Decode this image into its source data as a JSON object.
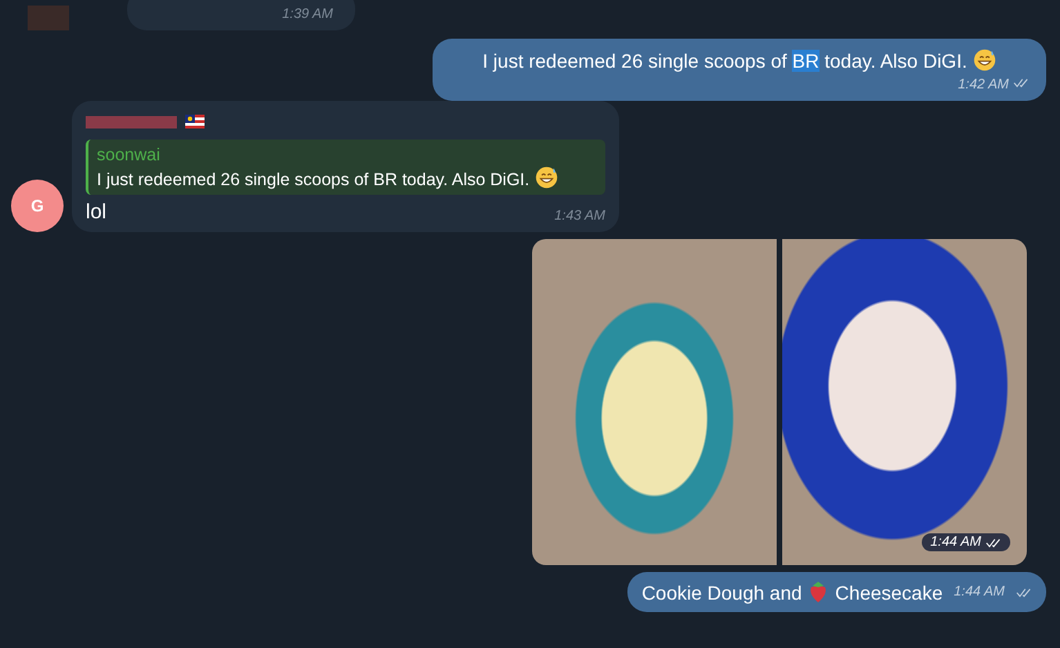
{
  "messages": [
    {
      "kind": "partial",
      "time": "1:39 AM"
    },
    {
      "kind": "text",
      "parts": [
        {
          "text": "I just redeemed 26 single scoops of ",
          "selected": false
        },
        {
          "text": "BR",
          "selected": true
        },
        {
          "text": " today. Also DiGI.",
          "selected": false
        }
      ],
      "time": "1:42 AM",
      "read": true
    },
    {
      "kind": "reply",
      "avatar": "G",
      "flag": true,
      "reply_to": {
        "author": "soonwai",
        "text": "I just redeemed 26 single scoops of BR today. Also DiGI."
      },
      "text": "lol",
      "time": "1:43 AM"
    },
    {
      "kind": "album",
      "time": "1:44 AM",
      "read": true
    },
    {
      "kind": "caption",
      "before": "Cookie Dough and",
      "after": "Cheesecake",
      "time": "1:44 AM",
      "read": true
    }
  ]
}
